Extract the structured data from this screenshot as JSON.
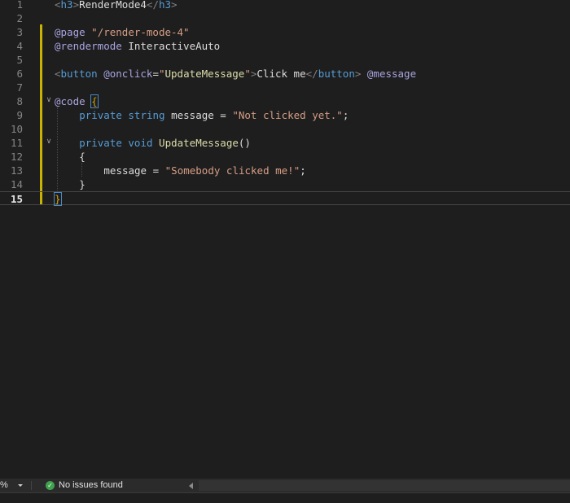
{
  "editor": {
    "lines": [
      {
        "n": "1",
        "tokens": [
          {
            "t": "<",
            "c": "t-bracket"
          },
          {
            "t": "h3",
            "c": "t-tag"
          },
          {
            "t": ">",
            "c": "t-bracket"
          },
          {
            "t": "RenderMode4",
            "c": "t-plain"
          },
          {
            "t": "</",
            "c": "t-bracket"
          },
          {
            "t": "h3",
            "c": "t-tag"
          },
          {
            "t": ">",
            "c": "t-bracket"
          }
        ]
      },
      {
        "n": "2",
        "tokens": []
      },
      {
        "n": "3",
        "tokens": [
          {
            "t": "@page",
            "c": "t-dir"
          },
          {
            "t": " ",
            "c": "t-plain"
          },
          {
            "t": "\"/render-mode-4\"",
            "c": "t-str"
          }
        ]
      },
      {
        "n": "4",
        "tokens": [
          {
            "t": "@rendermode",
            "c": "t-dir"
          },
          {
            "t": " InteractiveAuto",
            "c": "t-plain"
          }
        ]
      },
      {
        "n": "5",
        "tokens": []
      },
      {
        "n": "6",
        "tokens": [
          {
            "t": "<",
            "c": "t-bracket"
          },
          {
            "t": "button",
            "c": "t-tag"
          },
          {
            "t": " ",
            "c": "t-plain"
          },
          {
            "t": "@onclick",
            "c": "t-dir"
          },
          {
            "t": "=",
            "c": "t-plain"
          },
          {
            "t": "\"",
            "c": "t-str"
          },
          {
            "t": "UpdateMessage",
            "c": "t-method"
          },
          {
            "t": "\"",
            "c": "t-str"
          },
          {
            "t": ">",
            "c": "t-bracket"
          },
          {
            "t": "Click me",
            "c": "t-plain"
          },
          {
            "t": "</",
            "c": "t-bracket"
          },
          {
            "t": "button",
            "c": "t-tag"
          },
          {
            "t": ">",
            "c": "t-bracket"
          },
          {
            "t": " ",
            "c": "t-plain"
          },
          {
            "t": "@message",
            "c": "t-dir"
          }
        ]
      },
      {
        "n": "7",
        "tokens": []
      },
      {
        "n": "8",
        "tokens": [
          {
            "t": "@code",
            "c": "t-dir"
          },
          {
            "t": " ",
            "c": "t-plain"
          },
          {
            "t": "{",
            "c": "t-brace-hl"
          }
        ]
      },
      {
        "n": "9",
        "indent": 4,
        "tokens": [
          {
            "t": "private",
            "c": "t-kw"
          },
          {
            "t": " ",
            "c": "t-plain"
          },
          {
            "t": "string",
            "c": "t-kw"
          },
          {
            "t": " message = ",
            "c": "t-plain"
          },
          {
            "t": "\"Not clicked yet.\"",
            "c": "t-str"
          },
          {
            "t": ";",
            "c": "t-plain"
          }
        ]
      },
      {
        "n": "10",
        "tokens": []
      },
      {
        "n": "11",
        "indent": 4,
        "tokens": [
          {
            "t": "private",
            "c": "t-kw"
          },
          {
            "t": " ",
            "c": "t-plain"
          },
          {
            "t": "void",
            "c": "t-kw"
          },
          {
            "t": " ",
            "c": "t-plain"
          },
          {
            "t": "UpdateMessage",
            "c": "t-method"
          },
          {
            "t": "()",
            "c": "t-plain"
          }
        ]
      },
      {
        "n": "12",
        "indent": 4,
        "tokens": [
          {
            "t": "{",
            "c": "t-plain"
          }
        ]
      },
      {
        "n": "13",
        "indent": 8,
        "tokens": [
          {
            "t": "message = ",
            "c": "t-plain"
          },
          {
            "t": "\"Somebody clicked me!\"",
            "c": "t-str"
          },
          {
            "t": ";",
            "c": "t-plain"
          }
        ]
      },
      {
        "n": "14",
        "indent": 4,
        "tokens": [
          {
            "t": "}",
            "c": "t-plain"
          }
        ]
      },
      {
        "n": "15",
        "active": true,
        "tokens": [
          {
            "t": "}",
            "c": "t-brace-hl"
          }
        ]
      }
    ]
  },
  "statusbar": {
    "zoom": "%",
    "issues": "No issues found"
  }
}
